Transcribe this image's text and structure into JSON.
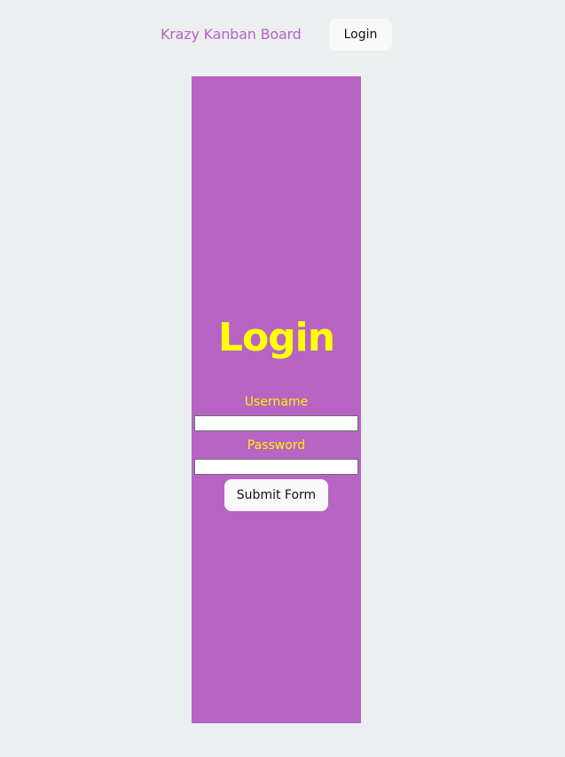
{
  "nav": {
    "brand": "Krazy Kanban Board",
    "login_label": "Login"
  },
  "form": {
    "title": "Login",
    "username_label": "Username",
    "username_value": "",
    "password_label": "Password",
    "password_value": "",
    "submit_label": "Submit Form"
  },
  "colors": {
    "page_background": "#ebeff0",
    "brand_text": "#b764c4",
    "panel_background": "#b764c4",
    "heading_text": "#ffff00",
    "button_background": "#f9f9f9"
  }
}
